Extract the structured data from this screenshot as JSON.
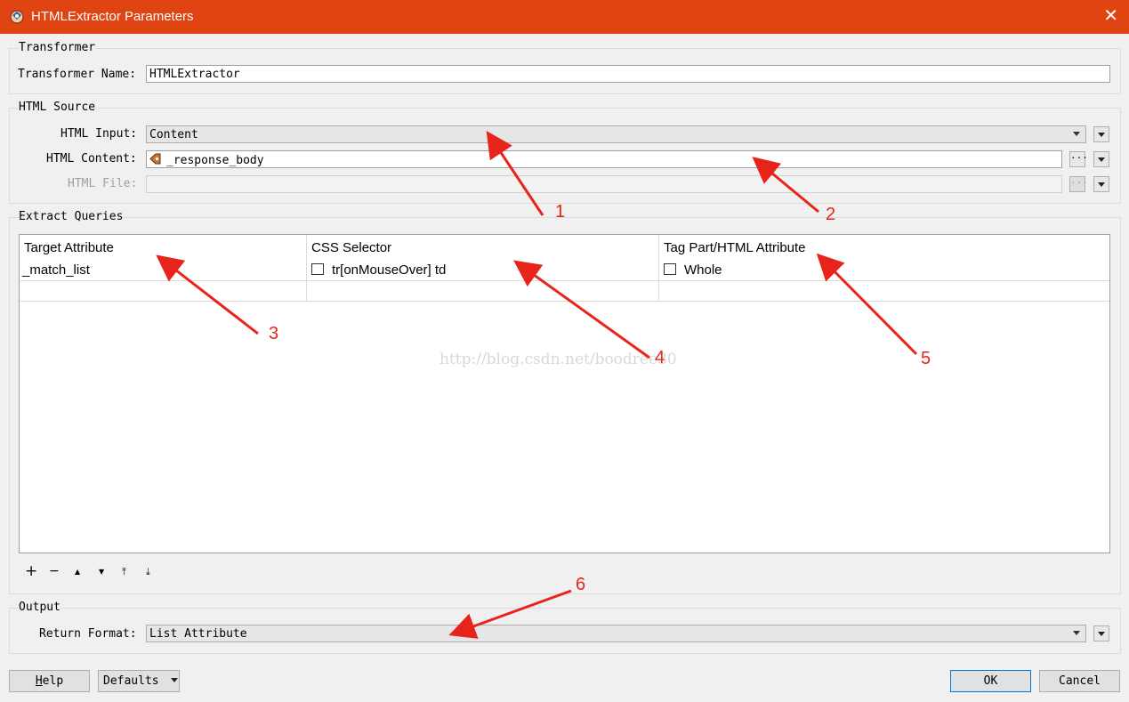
{
  "window": {
    "title": "HTMLExtractor Parameters",
    "close_glyph": "✕",
    "title_bar_color": "#e04412"
  },
  "transformer_group": {
    "legend": "Transformer",
    "name_label": "Transformer Name:",
    "name_value": "HTMLExtractor"
  },
  "html_source_group": {
    "legend": "HTML Source",
    "input_label": "HTML Input:",
    "input_value": "Content",
    "content_label": "HTML Content:",
    "content_value": "_response_body",
    "content_icon": "attribute-icon",
    "file_label": "HTML File:",
    "file_value": "",
    "more_glyph": "···"
  },
  "extract_queries_group": {
    "legend": "Extract Queries",
    "columns": [
      "Target Attribute",
      "CSS Selector",
      "Tag Part/HTML Attribute"
    ],
    "rows": [
      {
        "target": "_match_list",
        "selector": "tr[onMouseOver] td",
        "part": "Whole"
      }
    ],
    "toolbar": {
      "add": "+",
      "remove": "−",
      "up": "▲",
      "down": "▼",
      "top": "⤒",
      "bottom": "⤓"
    }
  },
  "output_group": {
    "legend": "Output",
    "format_label": "Return Format:",
    "format_value": "List Attribute"
  },
  "buttons": {
    "help_first": "H",
    "help_rest": "elp",
    "defaults": "Defaults",
    "ok": "OK",
    "cancel": "Cancel"
  },
  "annotations": [
    "1",
    "2",
    "3",
    "4",
    "5",
    "6"
  ],
  "annotation_color": "#e8241a",
  "watermark": "http://blog.csdn.net/boodree30"
}
